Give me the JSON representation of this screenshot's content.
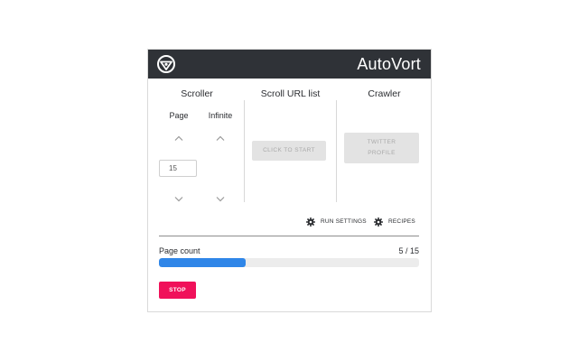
{
  "header": {
    "brand": "AutoVort",
    "logo_icon": "autovort-logo-icon"
  },
  "columns": {
    "scroller": {
      "title": "Scroller",
      "page_label": "Page",
      "infinite_label": "Infinite",
      "page_value": "15"
    },
    "url_list": {
      "title": "Scroll URL list",
      "start_label": "CLICK TO START"
    },
    "crawler": {
      "title": "Crawler",
      "twitter_line1": "TWITTER",
      "twitter_line2": "PROFILE"
    }
  },
  "settings": {
    "run_settings_label": "RUN SETTINGS",
    "recipes_label": "RECIPES",
    "icon": "gear-icon"
  },
  "progress": {
    "label": "Page count",
    "value_text": "5 / 15",
    "current": 5,
    "total": 15,
    "color": "#2f86e8"
  },
  "actions": {
    "stop_label": "STOP",
    "stop_color": "#f0115a"
  },
  "colors": {
    "header_bg": "#2f3237",
    "disabled_bg": "#e3e3e3"
  }
}
